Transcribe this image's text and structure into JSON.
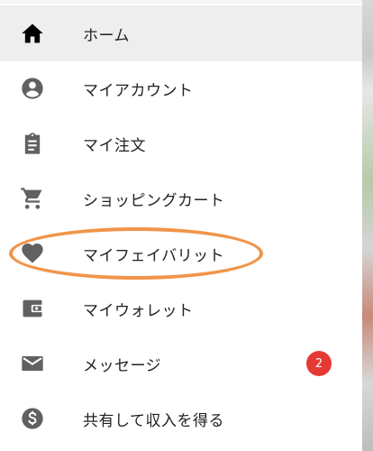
{
  "colors": {
    "icon": "#616161",
    "active_icon": "#000000",
    "active_background": "#eeeeee",
    "label": "#212121",
    "badge": "#e53935",
    "highlight": "#f0954a"
  },
  "menu": {
    "items": [
      {
        "label": "ホーム",
        "icon": "home-icon"
      },
      {
        "label": "マイアカウント",
        "icon": "account-circle-icon"
      },
      {
        "label": "マイ注文",
        "icon": "clipboard-icon"
      },
      {
        "label": "ショッピングカート",
        "icon": "shopping-cart-icon"
      },
      {
        "label": "マイフェイバリット",
        "icon": "heart-icon"
      },
      {
        "label": "マイウォレット",
        "icon": "wallet-icon"
      },
      {
        "label": "メッセージ",
        "icon": "mail-icon",
        "badge": "2"
      },
      {
        "label": "共有して収入を得る",
        "icon": "dollar-icon"
      }
    ]
  }
}
